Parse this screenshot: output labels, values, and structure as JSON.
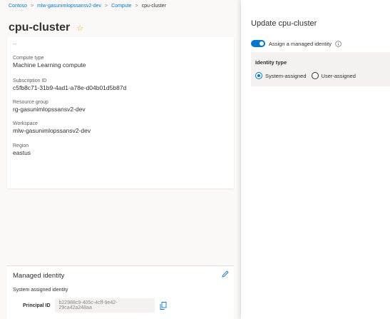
{
  "breadcrumb": {
    "items": [
      "Contoso",
      "mlw-gasunimlopssansv2-dev",
      "Compute"
    ],
    "current": "cpu-cluster"
  },
  "page": {
    "title": "cpu-cluster",
    "ellipsis": "--"
  },
  "properties": [
    {
      "label": "Compute type",
      "value": "Machine Learning compute"
    },
    {
      "label": "Subscription ID",
      "value": "c5fb8c71-31b9-4ad1-a78e-d04b01d5b87d"
    },
    {
      "label": "Resource group",
      "value": "rg-gasunimlopssansv2-dev"
    },
    {
      "label": "Workspace",
      "value": "mlw-gasunimlopssansv2-dev"
    },
    {
      "label": "Region",
      "value": "eastus"
    }
  ],
  "managed_identity": {
    "title": "Managed identity",
    "subtitle": "System assigned identity",
    "principal_label": "Principal ID",
    "principal_value": "b22988c9-405c-4cff-9e42-29ca42a248aa"
  },
  "panel": {
    "title": "Update cpu-cluster",
    "toggle_label": "Assign a managed identity",
    "toggle_on": true,
    "identity_type_label": "Identity type",
    "options": [
      {
        "label": "System-assigned",
        "checked": true
      },
      {
        "label": "User-assigned",
        "checked": false
      }
    ]
  },
  "icons": {
    "star": "star-icon",
    "edit": "pencil-icon",
    "copy": "copy-icon",
    "info": "info-icon"
  },
  "colors": {
    "accent": "#0078d4",
    "star": "#f4a100"
  }
}
